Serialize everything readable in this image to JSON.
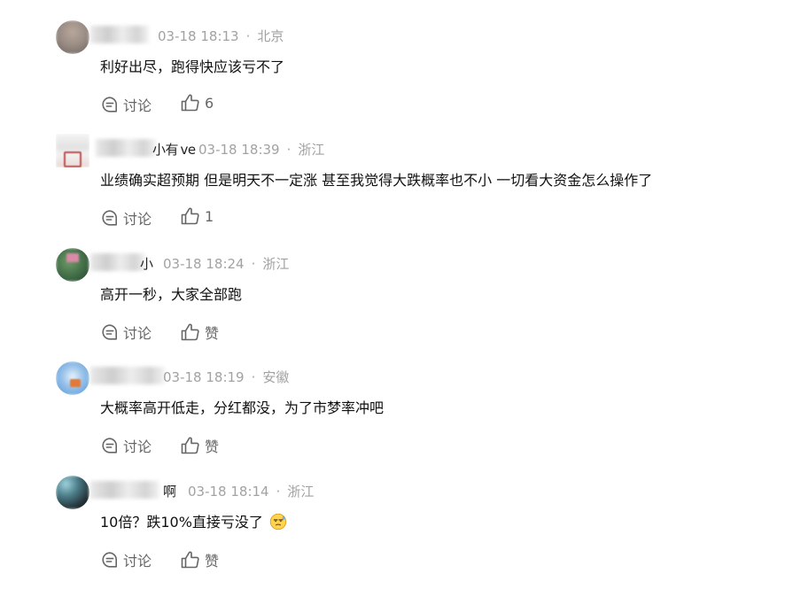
{
  "comments": [
    {
      "name_suffix": "",
      "time": "03-18 18:13",
      "separator": "·",
      "location": "北京",
      "text": "利好出尽，跑得快应该亏不了",
      "discuss_label": "讨论",
      "like_label": "6",
      "avatar_color": "#9c8f86"
    },
    {
      "name_suffix": "小有 ve",
      "time": "03-18 18:39",
      "separator": "·",
      "location": "浙江",
      "text": "业绩确实超预期 但是明天不一定涨 甚至我觉得大跌概率也不小 一切看大资金怎么操作了",
      "discuss_label": "讨论",
      "like_label": "1",
      "avatar_color": "#d9d9d9"
    },
    {
      "name_suffix": "小",
      "time": "03-18 18:24",
      "separator": "·",
      "location": "浙江",
      "text": "高开一秒，大家全部跑",
      "discuss_label": "讨论",
      "like_label": "赞",
      "avatar_color": "#3f6b45"
    },
    {
      "name_suffix": "",
      "time": "03-18 18:19",
      "separator": "·",
      "location": "安徽",
      "text": "大概率高开低走，分红都没，为了市梦率冲吧",
      "discuss_label": "讨论",
      "like_label": "赞",
      "avatar_color": "#6aa6dc"
    },
    {
      "name_suffix": "啊",
      "time": "03-18 18:14",
      "separator": "·",
      "location": "浙江",
      "text": "10倍？跌10%直接亏没了",
      "discuss_label": "讨论",
      "like_label": "赞",
      "avatar_color": "#1f2a2f",
      "emoji": "sweat-emoji"
    }
  ],
  "icons": {
    "discuss": "discuss-icon",
    "like": "thumbs-up-icon"
  },
  "colors": {
    "meta_gray": "#a2a2a2",
    "action_gray": "#666666",
    "text": "#111111"
  }
}
